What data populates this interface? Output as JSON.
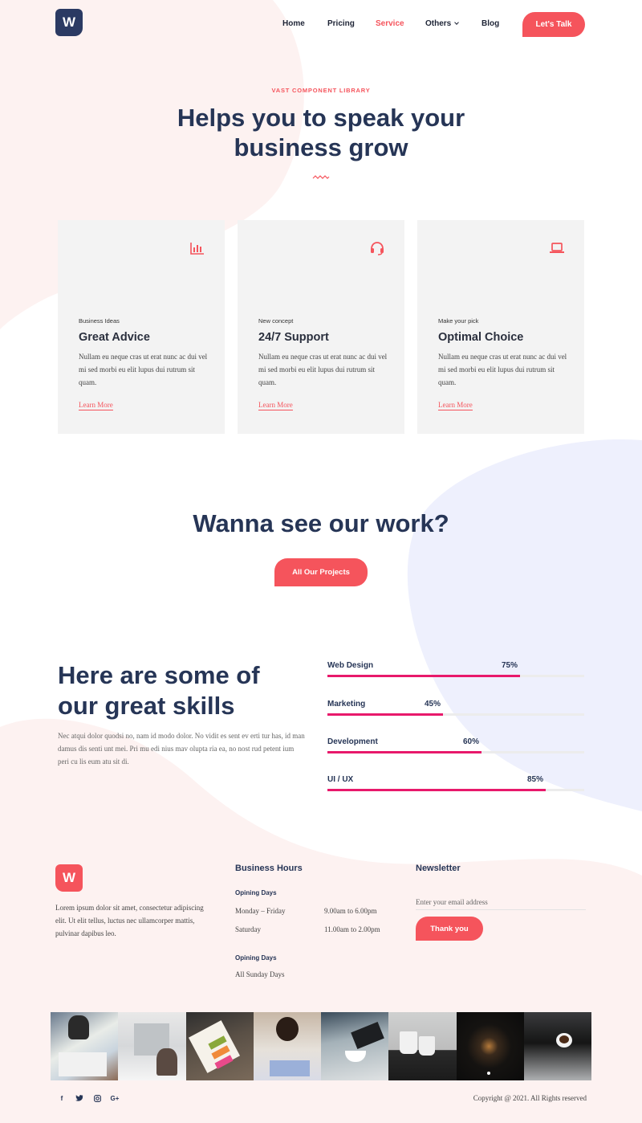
{
  "brand": {
    "logo_letter": "W"
  },
  "nav": {
    "items": [
      {
        "label": "Home",
        "active": false
      },
      {
        "label": "Pricing",
        "active": false
      },
      {
        "label": "Service",
        "active": true
      },
      {
        "label": "Others",
        "active": false,
        "has_dropdown": true
      },
      {
        "label": "Blog",
        "active": false
      }
    ],
    "cta": "Let's Talk"
  },
  "hero": {
    "eyebrow": "VAST COMPONENT LIBRARY",
    "title_line1": "Helps you to speak your",
    "title_line2": "business grow"
  },
  "cards": [
    {
      "icon": "bar-chart-icon",
      "kicker": "Business Ideas",
      "title": "Great Advice",
      "body": "Nullam eu neque cras ut erat nunc ac dui vel mi sed morbi eu elit lupus dui rutrum sit quam.",
      "link": "Learn More"
    },
    {
      "icon": "headset-icon",
      "kicker": "New concept",
      "title": "24/7 Support",
      "body": "Nullam eu neque cras ut erat nunc ac dui vel mi sed morbi eu elit lupus dui rutrum sit quam.",
      "link": "Learn More"
    },
    {
      "icon": "laptop-icon",
      "kicker": "Make your pick",
      "title": "Optimal Choice",
      "body": "Nullam eu neque cras ut erat nunc ac dui vel mi sed morbi eu elit lupus dui rutrum sit quam.",
      "link": "Learn More"
    }
  ],
  "work": {
    "title": "Wanna see our work?",
    "button": "All Our Projects"
  },
  "skills": {
    "title_line1": "Here are some of",
    "title_line2": "our great skills",
    "text": "Nec atqui dolor quodsi no, nam id modo dolor. No vidit es sent ev erti tur has, id man damus dis senti unt mei. Pri mu edi nius mav olupta ria ea, no nost rud petent ium peri cu lis eum atu sit di.",
    "items": [
      {
        "label": "Web Design",
        "percent": 75,
        "percent_label": "75%"
      },
      {
        "label": "Marketing",
        "percent": 45,
        "percent_label": "45%"
      },
      {
        "label": "Development",
        "percent": 60,
        "percent_label": "60%"
      },
      {
        "label": "UI / UX",
        "percent": 85,
        "percent_label": "85%"
      }
    ]
  },
  "footer": {
    "logo_letter": "W",
    "about": "Lorem ipsum dolor sit amet, consectetur adipiscing elit. Ut elit tellus, luctus nec ullamcorper mattis, pulvinar dapibus leo.",
    "hours": {
      "title": "Business Hours",
      "group1_label": "Opining Days",
      "rows": [
        {
          "days": "Monday – Friday",
          "time": "9.00am to 6.00pm"
        },
        {
          "days": "Saturday",
          "time": "11.00am to 2.00pm"
        }
      ],
      "group2_label": "Opining Days",
      "closed": "All Sunday Days"
    },
    "newsletter": {
      "title": "Newsletter",
      "placeholder": "Enter your email address",
      "button": "Thank you"
    },
    "social": [
      "f",
      "t",
      "ig",
      "G+"
    ],
    "copyright": "Copyright @ 2021. All Rights reserved"
  },
  "colors": {
    "accent": "#f5545c",
    "navy": "#263556",
    "bar": "#e8196b",
    "card_bg": "#f3f3f3",
    "blob_pink": "#fdf2f1",
    "blob_blue": "#eef0fd"
  },
  "gallery": [
    "workshop-photo",
    "office-meeting-photo",
    "color-swatches-photo",
    "woman-drawing-photo",
    "coffee-laptop-photo",
    "cups-photo",
    "dark-lamp-photo",
    "espresso-photo"
  ]
}
